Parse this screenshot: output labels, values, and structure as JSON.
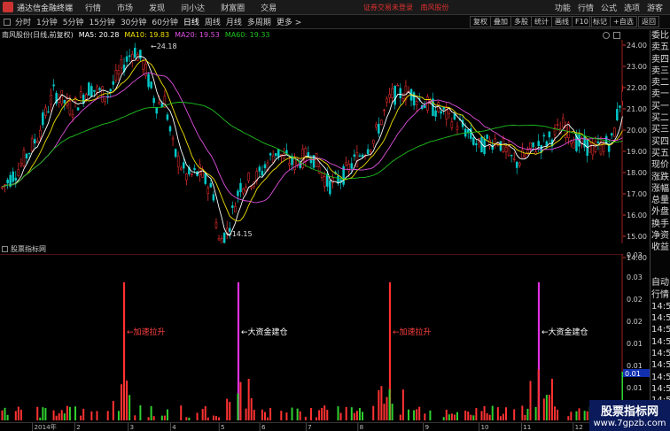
{
  "titlebar": {
    "app_name": "通达信金融终端",
    "menus": [
      "行情",
      "市场",
      "发现",
      "问小达",
      "财富圈",
      "交易"
    ],
    "notice": "证券交易未登录",
    "stock": "南风股份",
    "right_items": [
      "功能",
      "行情",
      "公式",
      "选项",
      "游客"
    ]
  },
  "toolbar": {
    "periods": [
      "分时",
      "1分钟",
      "5分钟",
      "15分钟",
      "30分钟",
      "60分钟",
      "日线",
      "周线",
      "月线",
      "多周期",
      "更多 >"
    ],
    "buttons": [
      "复权",
      "叠加",
      "多股",
      "统计",
      "画线",
      "F10",
      "标记",
      "+自选",
      "返回"
    ]
  },
  "info": {
    "stock_label": "南风股份(日线,前复权)",
    "ma5": "MA5: 20.28",
    "ma10": "MA10: 19.83",
    "ma20": "MA20: 19.53",
    "ma60": "MA60: 19.33"
  },
  "price_axis": [
    "24.00",
    "23.00",
    "22.00",
    "21.00",
    "20.00",
    "19.00",
    "18.00",
    "17.00",
    "16.00",
    "15.00",
    "14.00"
  ],
  "annotations": {
    "high": "24.18",
    "low": "14.15"
  },
  "indicator": {
    "title": "股票指标网",
    "labels": [
      "加速拉升",
      "大资金建仓",
      "加速拉升",
      "大资金建仓"
    ],
    "axis": [
      "0.03",
      "0.03",
      "0.02",
      "0.02",
      "0.01",
      "0.01",
      "0.01"
    ],
    "current": "0.01"
  },
  "dates": [
    "2014年",
    "2",
    "3",
    "4",
    "5",
    "6",
    "7",
    "8",
    "9",
    "10",
    "11",
    "12"
  ],
  "sidebar": [
    "委比",
    "卖五",
    "卖四",
    "卖三",
    "卖二",
    "卖一",
    "买一",
    "买二",
    "买三",
    "买四",
    "买五",
    "现价",
    "涨跌",
    "涨幅",
    "总量",
    "外盘",
    "换手",
    "净资",
    "收益",
    "",
    "",
    "自动",
    "行情",
    "14:55",
    "14:55",
    "14:55",
    "14:55",
    "14:56",
    "14:56",
    "14:56",
    "14:56",
    "14:56",
    "14:56"
  ],
  "watermark": {
    "line1": "股票指标网",
    "line2": "www.7gpzb.com"
  },
  "colors": {
    "up": "#ff3232",
    "down": "#00c8c8",
    "ma5": "#ffffff",
    "ma10": "#f0e000",
    "ma20": "#e050e0",
    "ma60": "#20c020",
    "vol_down": "#30d030",
    "magenta": "#e030e0"
  }
}
